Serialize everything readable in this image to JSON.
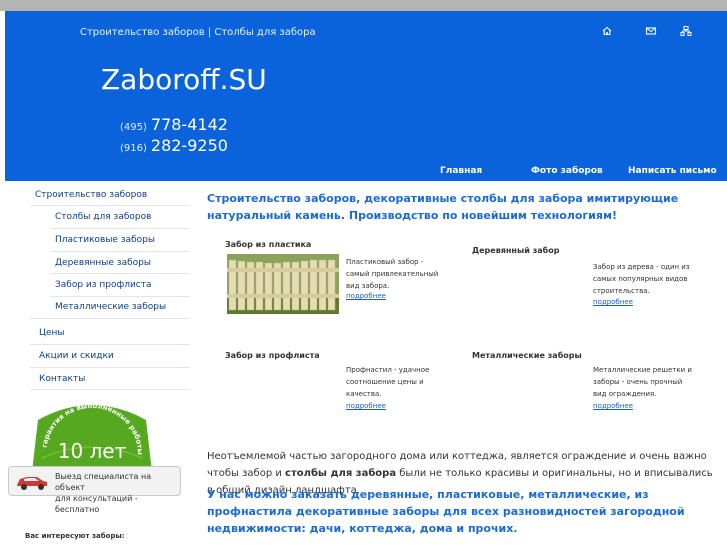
{
  "header": {
    "breadcrumb": "Строительство заборов | Столбы для забора",
    "site_name": "Zaboroff.SU",
    "phones": [
      {
        "code": "(495)",
        "number": "778-4142"
      },
      {
        "code": "(916)",
        "number": "282-9250"
      }
    ],
    "icons": [
      "home-icon",
      "mail-icon",
      "sitemap-icon"
    ]
  },
  "nav": {
    "home": "Главная",
    "photos": "Фото заборов",
    "write": "Написать письмо"
  },
  "sidebar": {
    "items": [
      "Строительство заборов",
      "Столбы для заборов",
      "Пластиковые заборы",
      "Деревянные заборы",
      "Забор из профлиста",
      "Металлические заборы",
      "Цены",
      "Акции и скидки",
      "Контакты"
    ],
    "badge_text": "гарантия на выполненные работы",
    "badge_years": "10 лет",
    "consult_line1": "Выезд специалиста на объект",
    "consult_line2": "для консультаций - бесплатно",
    "interest_label": "Вас интересуют заборы:"
  },
  "main": {
    "lead": "Строительство заборов, декоративные столбы для забора имитирующие натуральный камень. Производство по новейшим технологиям!",
    "products": [
      {
        "title": "Забор из пластика",
        "bold": "",
        "desc": "Пластиковый забор - самый привлекательный вид забора.",
        "more": "подробнее"
      },
      {
        "title": "Деревянный забор",
        "bold": "",
        "desc": "Забор из дерева - один из самых популярных видов строительства.",
        "more": "подробнее"
      },
      {
        "title": "Забор из профлиста",
        "bold": "",
        "desc": "Профнастил - удачное соотношение цены и качества.",
        "more": "подробнее"
      },
      {
        "title": "Металлические заборы",
        "bold": "",
        "desc": "Металлические решетки и заборы - очень прочный вид ограждения.",
        "more": "подробнее"
      }
    ],
    "para_a": "Неотъемлемой частью загородного дома или коттеджа, является ограждение и очень важно чтобы забор и ",
    "para_bold": "столбы для забора",
    "para_b": " были не только красивы и оригинальны, но и вписывались в общий дизайн ландшафта.",
    "para2": "У нас можно заказать деревянные, пластиковые, металлические, из профнастила декоративные заборы для всех разновидностей загородной недвижимости: дачи, коттеджа, дома и прочих."
  },
  "colors": {
    "header_blue": "#0b63dc",
    "lead_blue": "#1b6bd3",
    "badge_green": "#55a81f"
  }
}
